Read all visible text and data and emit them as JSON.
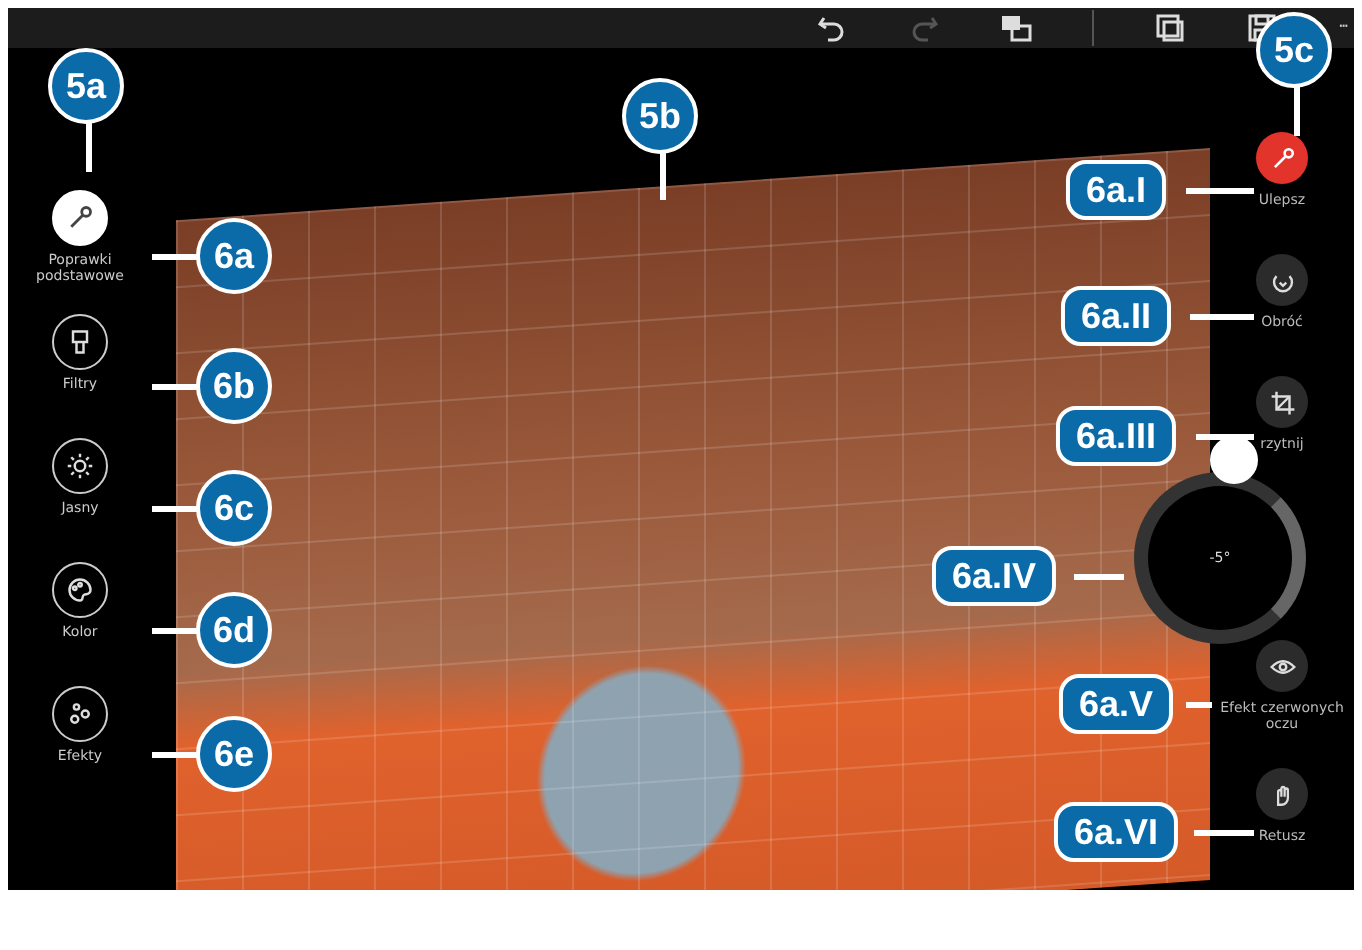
{
  "toolbar": {
    "buttons": [
      {
        "kind": "undo",
        "disabled": false
      },
      {
        "kind": "redo",
        "disabled": true
      },
      {
        "kind": "compare",
        "disabled": false
      },
      {
        "kind": "save-copy",
        "disabled": false
      },
      {
        "kind": "save",
        "disabled": false
      }
    ],
    "more": "···"
  },
  "left_tools": [
    {
      "kind": "wand",
      "label": "Poprawki podstawowe",
      "selected": true
    },
    {
      "kind": "filter",
      "label": "Filtry",
      "selected": false
    },
    {
      "kind": "sun",
      "label": "Jasny",
      "selected": false
    },
    {
      "kind": "palette",
      "label": "Kolor",
      "selected": false
    },
    {
      "kind": "effects",
      "label": "Efekty",
      "selected": false
    }
  ],
  "right_tools": [
    {
      "kind": "enhance",
      "label": "Ulepsz",
      "selected": true
    },
    {
      "kind": "rotate",
      "label": "Obróć",
      "selected": false
    },
    {
      "kind": "crop",
      "label": "rzytnij",
      "selected": false
    },
    {
      "kind": "eye",
      "label": "Efekt czerwonych oczu",
      "selected": false
    },
    {
      "kind": "retouch",
      "label": "Retusz",
      "selected": false
    }
  ],
  "rotation_dial": {
    "reading": "-5°"
  },
  "callouts": [
    {
      "label": "5a",
      "kind": "circle"
    },
    {
      "label": "5b",
      "kind": "circle"
    },
    {
      "label": "5c",
      "kind": "circle"
    },
    {
      "label": "6a",
      "kind": "circle"
    },
    {
      "label": "6b",
      "kind": "circle"
    },
    {
      "label": "6c",
      "kind": "circle"
    },
    {
      "label": "6d",
      "kind": "circle"
    },
    {
      "label": "6e",
      "kind": "circle"
    },
    {
      "label": "6a.I",
      "kind": "pill"
    },
    {
      "label": "6a.II",
      "kind": "pill"
    },
    {
      "label": "6a.III",
      "kind": "pill"
    },
    {
      "label": "6a.IV",
      "kind": "pill"
    },
    {
      "label": "6a.V",
      "kind": "pill"
    },
    {
      "label": "6a.VI",
      "kind": "pill"
    }
  ]
}
